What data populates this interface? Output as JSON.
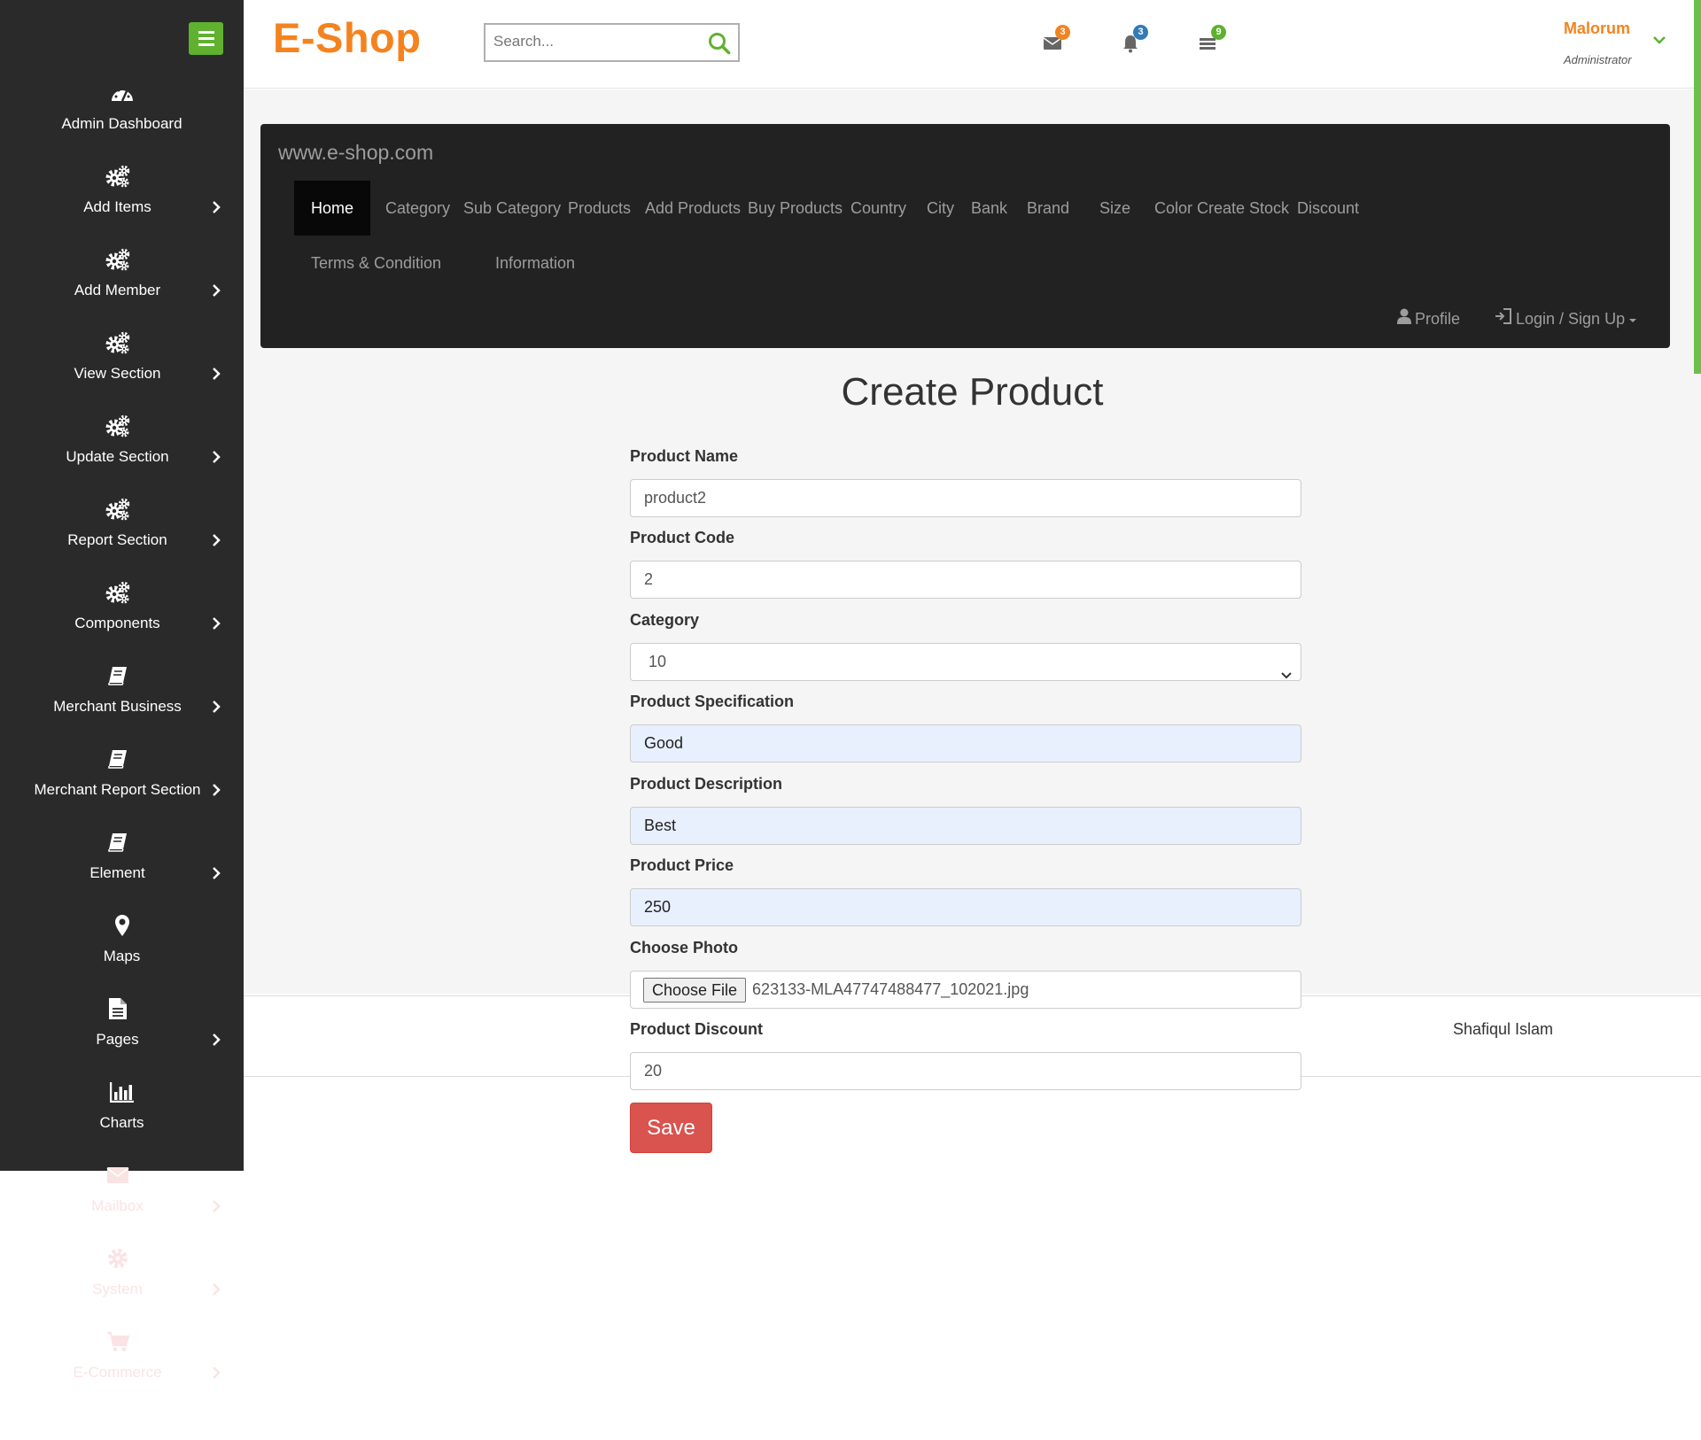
{
  "sidebar": {
    "items": [
      {
        "label": "Admin Dashboard",
        "icon": "dashboard-icon",
        "chevron": false
      },
      {
        "label": "Add Items",
        "icon": "gears-icon",
        "chevron": true
      },
      {
        "label": "Add Member",
        "icon": "gears-icon",
        "chevron": true
      },
      {
        "label": "View Section",
        "icon": "gears-icon",
        "chevron": true
      },
      {
        "label": "Update Section",
        "icon": "gears-icon",
        "chevron": true
      },
      {
        "label": "Report Section",
        "icon": "gears-icon",
        "chevron": true
      },
      {
        "label": "Components",
        "icon": "gears-icon",
        "chevron": true
      },
      {
        "label": "Merchant Business",
        "icon": "book-icon",
        "chevron": true
      },
      {
        "label": "Merchant Report Section",
        "icon": "book-icon",
        "chevron": true
      },
      {
        "label": "Element",
        "icon": "book-icon",
        "chevron": true
      },
      {
        "label": "Maps",
        "icon": "map-marker-icon",
        "chevron": false
      },
      {
        "label": "Pages",
        "icon": "file-icon",
        "chevron": true
      },
      {
        "label": "Charts",
        "icon": "bar-chart-icon",
        "chevron": false
      },
      {
        "label": "Mailbox",
        "icon": "envelope-icon",
        "chevron": true
      },
      {
        "label": "System",
        "icon": "gear-icon",
        "chevron": true
      },
      {
        "label": "E-Commerce",
        "icon": "cart-icon",
        "chevron": true
      }
    ]
  },
  "header": {
    "brand": "E-Shop",
    "search_placeholder": "Search...",
    "notifications": [
      {
        "icon": "envelope-icon",
        "count": "3",
        "color": "#f4831f"
      },
      {
        "icon": "bell-icon",
        "count": "3",
        "color": "#337ab7"
      },
      {
        "icon": "list-icon",
        "count": "9",
        "color": "#5fb12f"
      }
    ],
    "user": {
      "name": "Malorum",
      "role": "Administrator"
    }
  },
  "navbar": {
    "brand": "www.e-shop.com",
    "links": [
      "Home",
      "Category",
      "Sub Category",
      "Products",
      "Add Products",
      "Buy Products",
      "Country",
      "City",
      "Bank",
      "Brand",
      "Size",
      "Color",
      "Create Stock",
      "Discount",
      "Terms & Condition",
      "Information"
    ],
    "active": "Home",
    "profile": "Profile",
    "login": "Login / Sign Up"
  },
  "page": {
    "title": "Create Product"
  },
  "form": {
    "product_name": {
      "label": "Product Name",
      "value": "product2"
    },
    "product_code": {
      "label": "Product Code",
      "value": "2"
    },
    "category": {
      "label": "Category",
      "value": "10"
    },
    "specification": {
      "label": "Product Specification",
      "value": "Good"
    },
    "description": {
      "label": "Product Description",
      "value": "Best"
    },
    "price": {
      "label": "Product Price",
      "value": "250"
    },
    "photo": {
      "label": "Choose Photo",
      "button": "Choose File",
      "filename": "623133-MLA47747488477_102021.jpg"
    },
    "discount": {
      "label": "Product Discount",
      "value": "20"
    },
    "save_label": "Save"
  },
  "footer": {
    "author": "Shafiqul Islam"
  },
  "colors": {
    "accent_orange": "#f4831f",
    "accent_green": "#5fb12f",
    "sidebar_bg": "#2a2a2a",
    "navbar_bg": "#222222",
    "save_red": "#d9534f"
  }
}
